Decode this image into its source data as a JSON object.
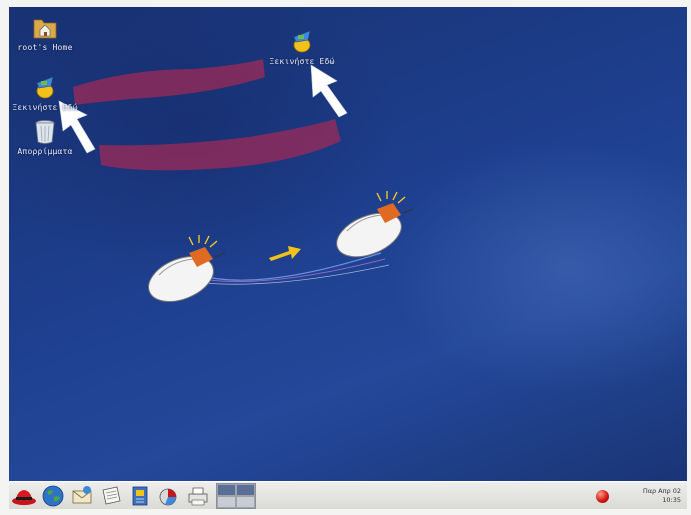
{
  "desktop": {
    "icons": [
      {
        "name": "home-folder-icon",
        "label": "root's Home"
      },
      {
        "name": "start-here-icon",
        "label": "Ξεκινήστε Εδώ"
      },
      {
        "name": "trash-icon",
        "label": "Απορρίμματα"
      },
      {
        "name": "start-here-icon",
        "label": "Ξεκινήστε Εδώ"
      }
    ],
    "annotation_colors": {
      "highlight": "#9e2a57",
      "arrow": "#f2c21b",
      "pointer": "#ffffff"
    }
  },
  "taskbar": {
    "launchers": [
      {
        "name": "redhat-main-menu-icon"
      },
      {
        "name": "web-browser-icon"
      },
      {
        "name": "email-client-icon"
      },
      {
        "name": "text-editor-icon"
      },
      {
        "name": "office-writer-icon"
      },
      {
        "name": "presentation-icon"
      },
      {
        "name": "print-manager-icon"
      }
    ],
    "clock": {
      "date": "Παρ Απρ 02",
      "time": "10:35"
    },
    "status_icon": "red-status-icon"
  }
}
